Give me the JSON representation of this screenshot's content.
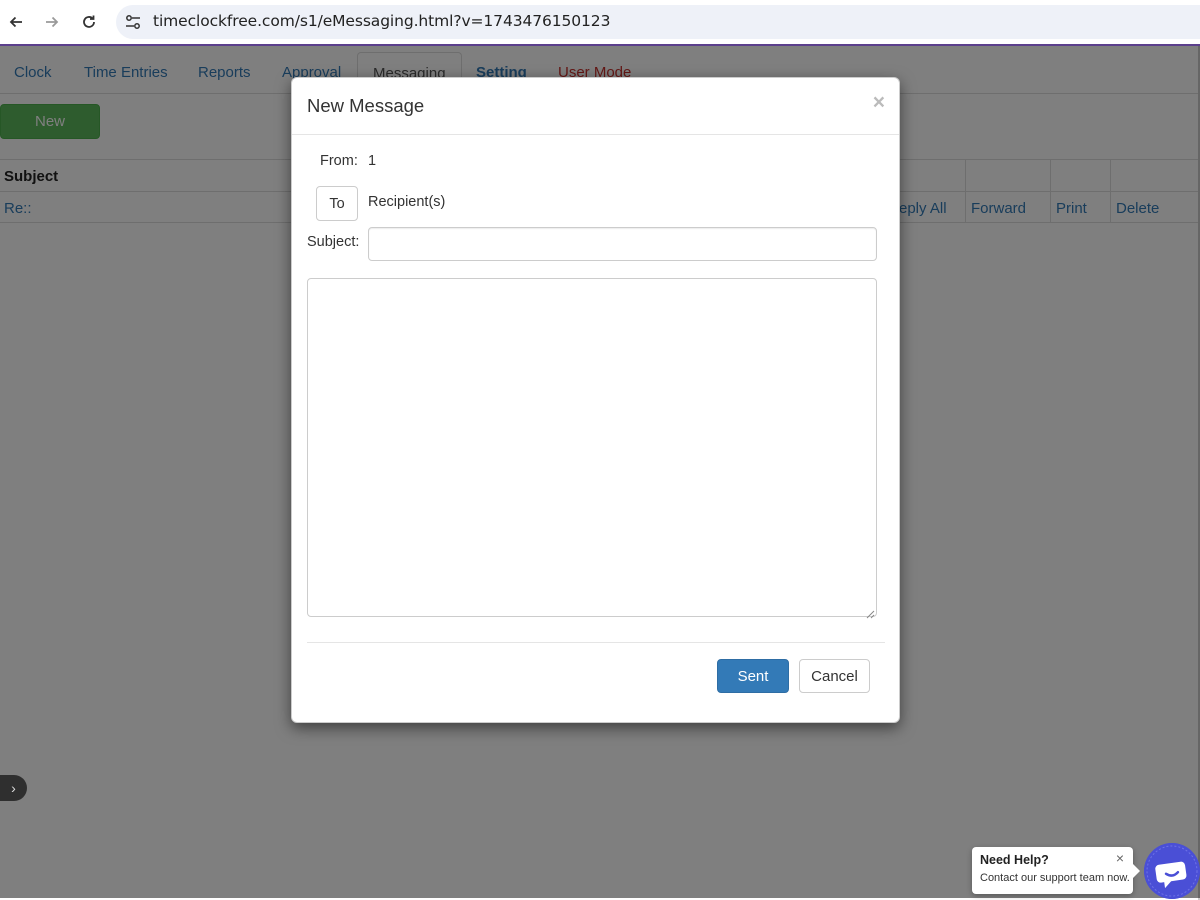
{
  "browser": {
    "url": "timeclockfree.com/s1/eMessaging.html?v=1743476150123"
  },
  "tabs": [
    {
      "label": "Clock"
    },
    {
      "label": "Time Entries"
    },
    {
      "label": "Reports"
    },
    {
      "label": "Approval"
    },
    {
      "label": "Messaging"
    },
    {
      "label": "Setting"
    },
    {
      "label": "User Mode"
    }
  ],
  "toolbar": {
    "new_label": "New"
  },
  "table": {
    "headers": {
      "subject": "Subject"
    },
    "row": {
      "subject": "Re::",
      "reply_all": "eply All",
      "forward": "Forward",
      "print": "Print",
      "delete": "Delete"
    }
  },
  "modal": {
    "title": "New Message",
    "close": "×",
    "from_label": "From:",
    "from_value": "1",
    "to_label": "To",
    "recipients": "Recipient(s)",
    "subject_label": "Subject:",
    "subject_value": "",
    "body_value": "",
    "sent_label": "Sent",
    "cancel_label": "Cancel"
  },
  "help": {
    "title": "Need Help?",
    "subtitle": "Contact our support team now.",
    "close": "×"
  },
  "colors": {
    "link": "#337ab7",
    "primary": "#337ab7",
    "success": "#5cb85c",
    "danger_text": "#c9302c",
    "chat": "#4a4fd6"
  }
}
